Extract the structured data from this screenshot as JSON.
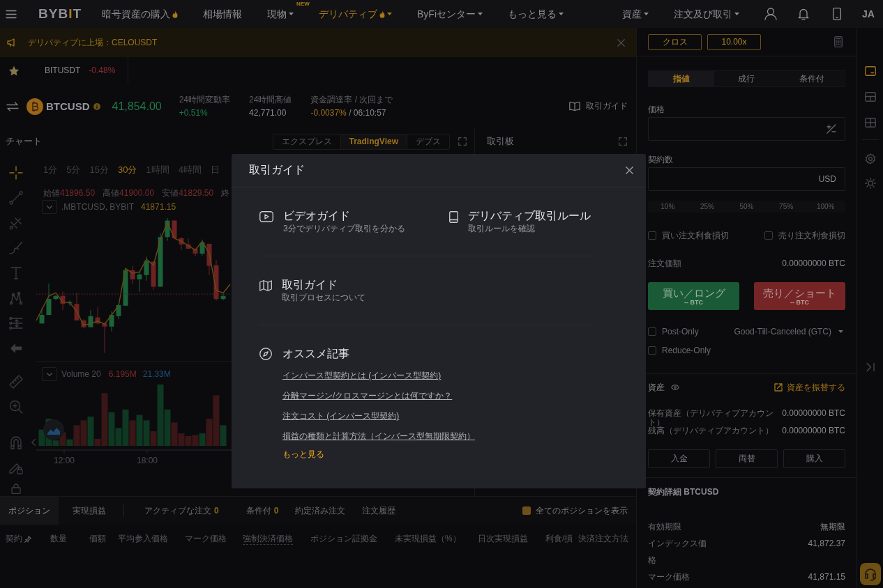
{
  "nav": {
    "logo": [
      "BYB",
      "I",
      "T"
    ],
    "items": [
      {
        "label": "暗号資産の購入",
        "hot": true,
        "dropdown": false,
        "selected": false
      },
      {
        "label": "相場情報",
        "hot": false,
        "dropdown": false,
        "selected": false
      },
      {
        "label": "現物",
        "hot": false,
        "dropdown": true,
        "badge": "NEW",
        "selected": false
      },
      {
        "label": "デリバティブ",
        "hot": true,
        "dropdown": true,
        "selected": true
      },
      {
        "label": "ByFiセンター",
        "hot": false,
        "dropdown": true,
        "selected": false
      },
      {
        "label": "もっと見る",
        "hot": false,
        "dropdown": true,
        "selected": false
      }
    ],
    "account": [
      {
        "label": "資産",
        "dropdown": true
      },
      {
        "label": "注文及び取引",
        "dropdown": true
      }
    ],
    "language": "JA"
  },
  "banner": {
    "text": "デリバティブに上場：CELOUSDT"
  },
  "favorites": [
    {
      "symbol": "BITUSDT",
      "change": "-0.48%",
      "rising": false
    }
  ],
  "ticker": {
    "symbol": "BTCUSD",
    "price": "41,854.00",
    "rising": true,
    "stats": [
      {
        "kind": "up",
        "label": "24時間変動率",
        "value": "+0.51%"
      },
      {
        "kind": "plain",
        "label": "24時間高値",
        "value": "42,771.00"
      },
      {
        "kind": "funding",
        "label": "資金調達率 / 次回まで",
        "value": "-0.0037%",
        "countdown": "/ 06:10:57"
      }
    ],
    "guide_link": "取引ガイド"
  },
  "chart": {
    "title": "チャート",
    "views": [
      {
        "label": "エクスプレス",
        "selected": false
      },
      {
        "label": "TradingView",
        "selected": true
      },
      {
        "label": "デプス",
        "selected": false
      }
    ],
    "tools": [
      {
        "selected": true
      },
      {
        "selected": false
      },
      {
        "selected": false
      },
      {
        "selected": false
      },
      {
        "selected": false
      },
      {
        "selected": false
      },
      {
        "selected": false
      },
      {
        "selected": false
      },
      {
        "selected": false
      },
      {
        "selected": false
      },
      {
        "selected": false
      },
      {
        "selected": false
      },
      {
        "selected": false
      }
    ],
    "intervals": [
      {
        "label": "1分",
        "selected": false
      },
      {
        "label": "5分",
        "selected": false
      },
      {
        "label": "15分",
        "selected": false
      },
      {
        "label": "30分",
        "selected": true
      },
      {
        "label": "1時間",
        "selected": false
      },
      {
        "label": "4時間",
        "selected": false
      },
      {
        "label": "日",
        "selected": false
      }
    ],
    "ohlc": [
      {
        "label": "始値",
        "value": "41896.50"
      },
      {
        "label": "高値",
        "value": "41900.00"
      },
      {
        "label": "安値",
        "value": "41829.50"
      },
      {
        "label": "終"
      }
    ],
    "series": {
      "name": ".MBTCUSD, BYBIT",
      "value": "41871.15"
    },
    "volume": {
      "name": "Volume 20",
      "values": [
        {
          "text": "6.195M",
          "color": "#7b2a2a"
        },
        {
          "text": "21.33M",
          "color": "#1f4f78"
        }
      ]
    },
    "time_labels": [
      "12:00",
      "18:00"
    ]
  },
  "orderbook": {
    "title": "取引板"
  },
  "positions": {
    "tabs": [
      {
        "label": "ポジション",
        "selected": true
      },
      {
        "label": "実現損益",
        "selected": false
      },
      {
        "label": "アクティブな注文",
        "count": "0",
        "selected": false
      },
      {
        "label": "条件付",
        "count": "0",
        "selected": false
      },
      {
        "label": "約定済み注文",
        "selected": false
      },
      {
        "label": "注文履歴",
        "selected": false
      }
    ],
    "show_all": {
      "label": "全てのポジションを表示",
      "checked": true
    },
    "columns": [
      {
        "label": "契約",
        "kind": "pinned"
      },
      {
        "label": "数量",
        "kind": "plain"
      },
      {
        "label": "価額",
        "kind": "plain"
      },
      {
        "label": "平均参入価格",
        "kind": "plain"
      },
      {
        "label": "マーク価格",
        "kind": "plain"
      },
      {
        "label": "強制決済価格",
        "kind": "hint"
      },
      {
        "label": "ポジション証拠金",
        "kind": "plain"
      },
      {
        "label": "未実現損益（%）",
        "kind": "plain"
      },
      {
        "label": "日次実現損益",
        "kind": "plain"
      },
      {
        "label": "利食/損",
        "kind": "plain"
      },
      {
        "label": "決済注文方法",
        "kind": "plain"
      }
    ]
  },
  "order_form": {
    "margin_mode": "クロス",
    "leverage": "10.00x",
    "order_types": [
      {
        "label": "指値",
        "selected": true
      },
      {
        "label": "成行",
        "selected": false
      },
      {
        "label": "条件付",
        "selected": false
      }
    ],
    "price_label": "価格",
    "quantity_label": "契約数",
    "quantity_unit": "USD",
    "percents": [
      "10%",
      "25%",
      "50%",
      "75%",
      "100%"
    ],
    "tp_sl": [
      {
        "label": "買い注文利食損切",
        "checked": false
      },
      {
        "label": "売り注文利食損切",
        "checked": false
      }
    ],
    "order_value": {
      "label": "注文価額",
      "value": "0.00000000 BTC"
    },
    "actions": [
      {
        "kind": "buy",
        "label": "買い／ロング",
        "amount": "-- BTC"
      },
      {
        "kind": "sell",
        "label": "売り／ショート",
        "amount": "-- BTC"
      }
    ],
    "flags": [
      {
        "label": "Post-Only",
        "checked": false
      },
      {
        "label": "Reduce-Only",
        "checked": false
      }
    ],
    "time_in_force": "Good-Till-Canceled (GTC)"
  },
  "assets": {
    "title": "資産",
    "transfer": "資産を振替する",
    "rows": [
      {
        "label": "保有資産（デリバティブアカウント）",
        "value": "0.00000000 BTC"
      },
      {
        "label": "残高（デリバティブアカウント）",
        "value": "0.00000000 BTC"
      }
    ],
    "buttons": [
      "入金",
      "両替",
      "購入"
    ]
  },
  "contract": {
    "title": "契約詳細 BTCUSD",
    "rows": [
      {
        "label": "有効期限",
        "value": "無期限"
      },
      {
        "label": "インデックス価格",
        "value": "41,872.37"
      },
      {
        "label": "マーク価格",
        "value": "41,871.15"
      }
    ]
  },
  "sidebar": {
    "views": [
      {
        "selected": true
      },
      {
        "selected": false
      },
      {
        "selected": false
      }
    ]
  },
  "modal": {
    "title": "取引ガイド",
    "guides": [
      {
        "kind": "video",
        "title": "ビデオガイド",
        "subtitle": "3分でデリバティブ取引を分かる"
      },
      {
        "kind": "rules",
        "title": "デリバティブ取引ルール",
        "subtitle": "取引ルールを確認"
      },
      {
        "kind": "map",
        "title": "取引ガイド",
        "subtitle": "取引プロセスについて"
      }
    ],
    "articles": {
      "title": "オススメ記事",
      "links": [
        "インバース型契約とは (インバース型契約)",
        "分離マージン/クロスマージンとは何ですか？",
        "注文コスト (インバース型契約)",
        "損益の種類と計算方法（インバース型無期限契約）"
      ],
      "more": "もっと見る"
    }
  }
}
